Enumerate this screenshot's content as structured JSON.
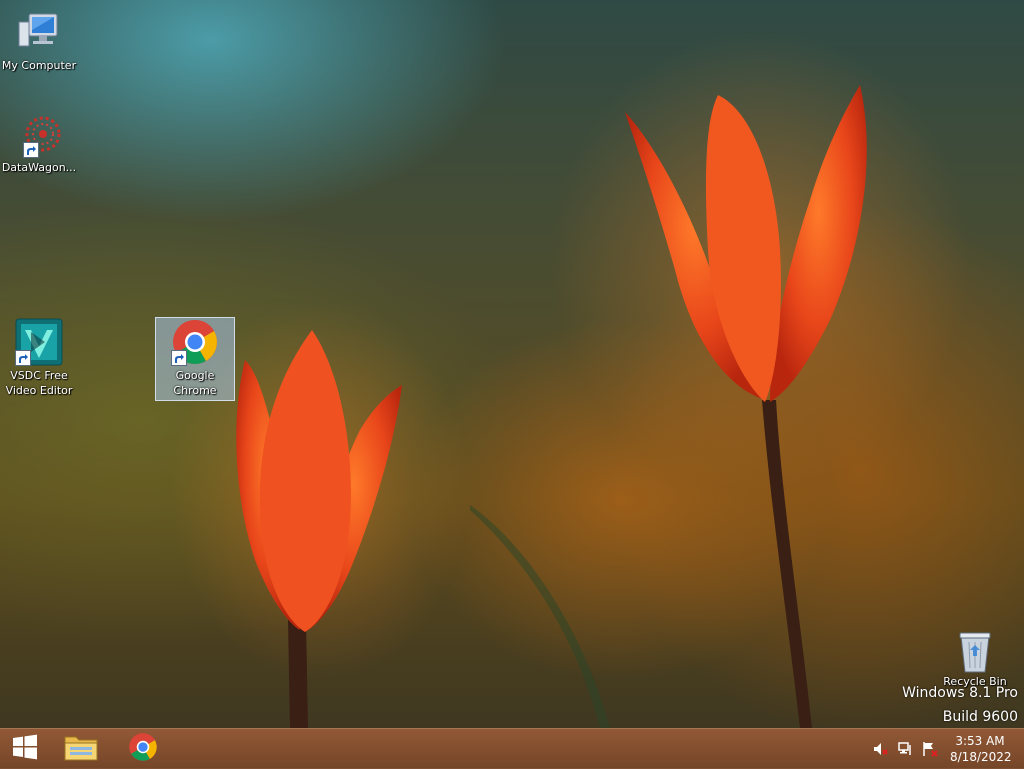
{
  "desktop": {
    "icons": [
      {
        "label": "My Computer",
        "icon": "computer-icon"
      },
      {
        "label": "DataWagon...",
        "icon": "datawagon-icon"
      },
      {
        "label": "VSDC Free Video Editor",
        "icon": "vsdc-icon"
      },
      {
        "label": "Google Chrome",
        "icon": "chrome-icon",
        "selected": true
      },
      {
        "label": "Recycle Bin",
        "icon": "recycle-bin-icon"
      }
    ],
    "watermark": {
      "line1": "Windows 8.1 Pro",
      "line2": "Build 9600"
    }
  },
  "taskbar": {
    "pinned": [
      {
        "name": "start",
        "icon": "windows-logo-icon"
      },
      {
        "name": "file-explorer",
        "icon": "folder-icon"
      },
      {
        "name": "chrome",
        "icon": "chrome-icon"
      }
    ],
    "tray": {
      "icons": [
        "speaker-muted-icon",
        "network-icon",
        "action-center-flag-icon"
      ],
      "time": "3:53 AM",
      "date": "8/18/2022"
    }
  },
  "colors": {
    "taskbar": "#87502f",
    "selection": "#aac8eb",
    "tulip": "#e8461a",
    "chrome_red": "#db4437",
    "chrome_green": "#0f9d58",
    "chrome_yellow": "#f4b400",
    "chrome_blue": "#4285f4"
  }
}
